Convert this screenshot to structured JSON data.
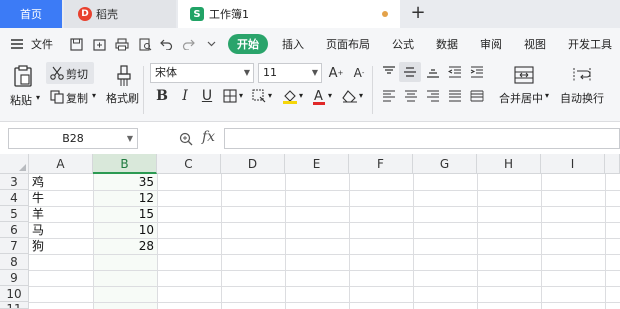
{
  "tabs": {
    "home": "首页",
    "docer": "稻壳",
    "docer_logo": "D",
    "workbook": "工作簿1",
    "workbook_icon": "S",
    "add": "+"
  },
  "menu": {
    "file": "文件",
    "start": "开始",
    "items": [
      "插入",
      "页面布局",
      "公式",
      "数据",
      "审阅",
      "视图",
      "开发工具"
    ]
  },
  "ribbon": {
    "paste": "粘贴",
    "cut": "剪切",
    "copy": "复制",
    "format_painter": "格式刷",
    "font_name": "宋体",
    "font_size": "11",
    "merge_center": "合并居中",
    "wrap_text": "自动换行"
  },
  "formula_bar": {
    "name_box": "B28",
    "fx_label": "fx",
    "formula": ""
  },
  "grid": {
    "columns": [
      "A",
      "B",
      "C",
      "D",
      "E",
      "F",
      "G",
      "H",
      "I"
    ],
    "selected_column": "B",
    "rows": [
      {
        "num": "3",
        "a": "鸡",
        "b": "35"
      },
      {
        "num": "4",
        "a": "牛",
        "b": "12"
      },
      {
        "num": "5",
        "a": "羊",
        "b": "15"
      },
      {
        "num": "6",
        "a": "马",
        "b": "10"
      },
      {
        "num": "7",
        "a": "狗",
        "b": "28"
      },
      {
        "num": "8",
        "a": "",
        "b": ""
      },
      {
        "num": "9",
        "a": "",
        "b": ""
      },
      {
        "num": "10",
        "a": "",
        "b": ""
      },
      {
        "num": "11",
        "a": "",
        "b": ""
      }
    ]
  },
  "colors": {
    "home_tab": "#3c7bf6",
    "start_button": "#2aa46b",
    "selected_column": "#2b9a52"
  }
}
